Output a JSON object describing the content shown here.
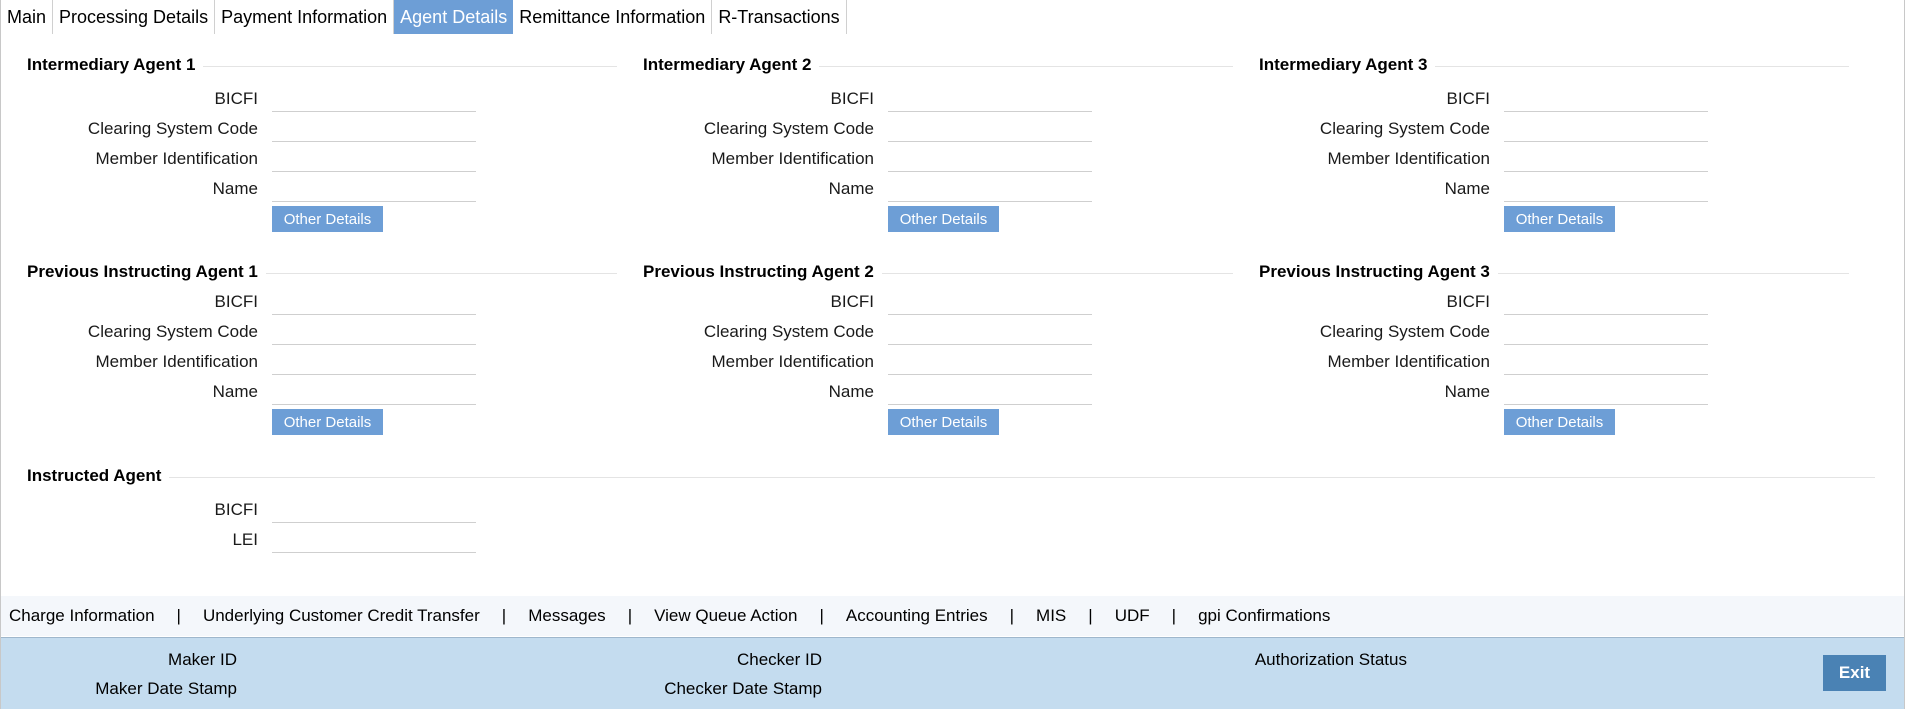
{
  "tabs": [
    {
      "label": "Main",
      "active": false
    },
    {
      "label": "Processing Details",
      "active": false
    },
    {
      "label": "Payment Information",
      "active": false
    },
    {
      "label": "Agent Details",
      "active": true
    },
    {
      "label": "Remittance Information",
      "active": false
    },
    {
      "label": "R-Transactions",
      "active": false
    }
  ],
  "sections": {
    "intermediary_1": {
      "title": "Intermediary Agent 1",
      "fields": [
        {
          "label": "BICFI",
          "value": ""
        },
        {
          "label": "Clearing System Code",
          "value": ""
        },
        {
          "label": "Member Identification",
          "value": ""
        },
        {
          "label": "Name",
          "value": ""
        }
      ],
      "button": "Other Details"
    },
    "intermediary_2": {
      "title": "Intermediary Agent 2",
      "fields": [
        {
          "label": "BICFI",
          "value": ""
        },
        {
          "label": "Clearing System Code",
          "value": ""
        },
        {
          "label": "Member Identification",
          "value": ""
        },
        {
          "label": "Name",
          "value": ""
        }
      ],
      "button": "Other Details"
    },
    "intermediary_3": {
      "title": "Intermediary Agent 3",
      "fields": [
        {
          "label": "BICFI",
          "value": ""
        },
        {
          "label": "Clearing System Code",
          "value": ""
        },
        {
          "label": "Member Identification",
          "value": ""
        },
        {
          "label": "Name",
          "value": ""
        }
      ],
      "button": "Other Details"
    },
    "previous_1": {
      "title": "Previous Instructing Agent 1",
      "fields": [
        {
          "label": "BICFI",
          "value": ""
        },
        {
          "label": "Clearing System Code",
          "value": ""
        },
        {
          "label": "Member Identification",
          "value": ""
        },
        {
          "label": "Name",
          "value": ""
        }
      ],
      "button": "Other Details"
    },
    "previous_2": {
      "title": "Previous Instructing Agent 2",
      "fields": [
        {
          "label": "BICFI",
          "value": ""
        },
        {
          "label": "Clearing System Code",
          "value": ""
        },
        {
          "label": "Member Identification",
          "value": ""
        },
        {
          "label": "Name",
          "value": ""
        }
      ],
      "button": "Other Details"
    },
    "previous_3": {
      "title": "Previous Instructing Agent 3",
      "fields": [
        {
          "label": "BICFI",
          "value": ""
        },
        {
          "label": "Clearing System Code",
          "value": ""
        },
        {
          "label": "Member Identification",
          "value": ""
        },
        {
          "label": "Name",
          "value": ""
        }
      ],
      "button": "Other Details"
    },
    "instructed": {
      "title": "Instructed Agent",
      "fields": [
        {
          "label": "BICFI",
          "value": ""
        },
        {
          "label": "LEI",
          "value": ""
        }
      ]
    }
  },
  "links": [
    "Charge Information",
    "Underlying Customer Credit Transfer",
    "Messages",
    "View Queue Action",
    "Accounting Entries",
    "MIS",
    "UDF",
    "gpi Confirmations"
  ],
  "link_separator": "|",
  "footer": {
    "maker_id": "Maker ID",
    "maker_date_stamp": "Maker Date Stamp",
    "checker_id": "Checker ID",
    "checker_date_stamp": "Checker Date Stamp",
    "authorization_status": "Authorization Status",
    "exit_label": "Exit"
  },
  "colors": {
    "accent": "#6d9ed6",
    "footer_bg": "#c4dcef",
    "exit_bg": "#4a82b4"
  }
}
